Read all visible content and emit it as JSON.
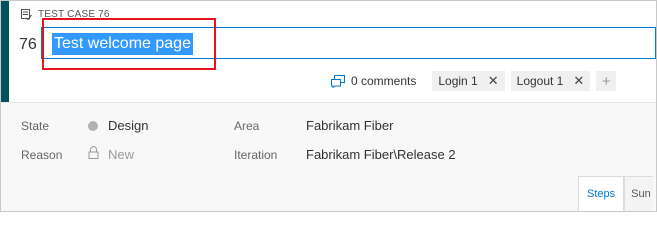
{
  "work_item": {
    "type_label": "TEST CASE 76",
    "id": "76",
    "title": "Test welcome page"
  },
  "toolbar": {
    "comments": "0 comments",
    "tags": [
      {
        "label": "Login 1"
      },
      {
        "label": "Logout 1"
      }
    ],
    "remove_glyph": "✕",
    "add_glyph": "+"
  },
  "fields": {
    "state_label": "State",
    "state_value": "Design",
    "reason_label": "Reason",
    "reason_value": "New",
    "area_label": "Area",
    "area_value": "Fabrikam Fiber",
    "iteration_label": "Iteration",
    "iteration_value": "Fabrikam Fiber\\Release 2"
  },
  "tabs": [
    {
      "label": "Steps"
    },
    {
      "label": "Sun"
    }
  ],
  "colors": {
    "accent": "#00525c",
    "selection": "#3399ff",
    "focus_border": "#0078d4",
    "highlight": "#e81123",
    "state_dot": "#b2b2b2"
  },
  "icons": {
    "type_icon": "test-case-icon",
    "comments_icon": "comments-icon",
    "lock_icon": "lock-icon"
  }
}
